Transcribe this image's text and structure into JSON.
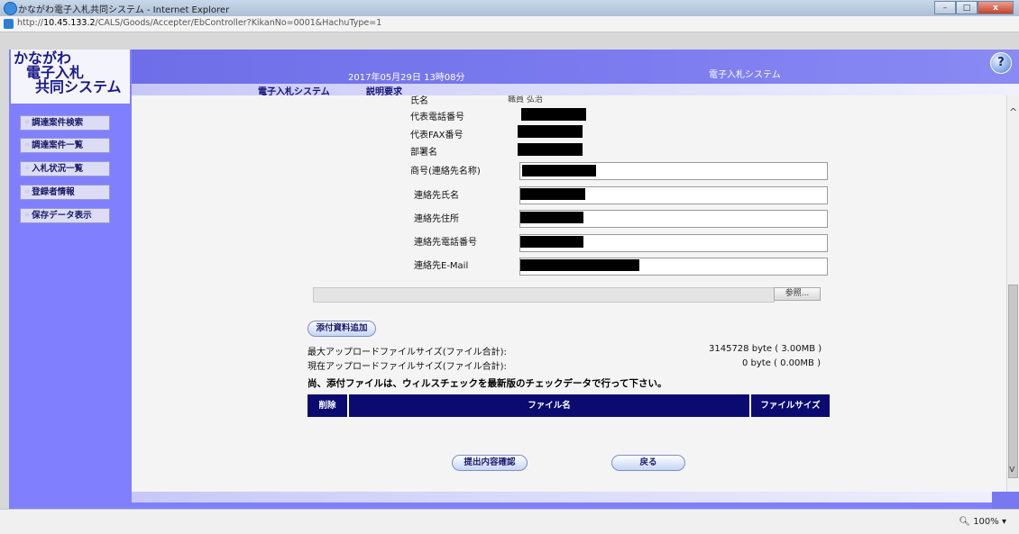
{
  "window": {
    "title": "かながわ電子入札共同システム - Internet Explorer",
    "controls": [
      "–",
      "□",
      "x"
    ]
  },
  "address": {
    "url_prefix": "http://",
    "url_host": "10.45.133.2",
    "url_path": "/CALS/Goods/Accepter/EbController?KikanNo=0001&HachuType=1"
  },
  "logo": {
    "line1": "かながわ",
    "line2": "電子入札",
    "line3": "共同システム"
  },
  "header": {
    "datetime": "2017年05月29日 13時08分",
    "system_name": "電子入札システム"
  },
  "menu": {
    "item1": "電子入札システム",
    "item2": "説明要求"
  },
  "sidebar": {
    "items": [
      {
        "label": "調達案件検索"
      },
      {
        "label": "調達案件一覧"
      },
      {
        "label": "入札状況一覧"
      },
      {
        "label": "登録者情報"
      },
      {
        "label": "保存データ表示"
      }
    ]
  },
  "form": {
    "partial_top_label": "氏名",
    "partial_top_value": "職員 弘治",
    "rep_phone_label": "代表電話番号",
    "rep_fax_label": "代表FAX番号",
    "dept_label": "部署名",
    "company_label": "商号(連絡先名称)",
    "contact_name_label": "連絡先氏名",
    "contact_address_label": "連絡先住所",
    "contact_phone_label": "連絡先電話番号",
    "contact_email_label": "連絡先E-Mail"
  },
  "attachments": {
    "browse_label": "参照...",
    "add_button": "添付資料追加",
    "max_size_label": "最大アップロードファイルサイズ(ファイル合計):",
    "max_size_value": "3145728 byte ( 3.00MB )",
    "current_size_label": "現在アップロードファイルサイズ(ファイル合計):",
    "current_size_value": "0 byte ( 0.00MB )",
    "note": "尚、添付ファイルは、ウィルスチェックを最新版のチェックデータで行って下さい。",
    "columns": [
      "削除",
      "ファイル名",
      "ファイルサイズ"
    ]
  },
  "actions": {
    "confirm": "提出内容確認",
    "back": "戻る"
  },
  "status": {
    "zoom": "100%"
  }
}
